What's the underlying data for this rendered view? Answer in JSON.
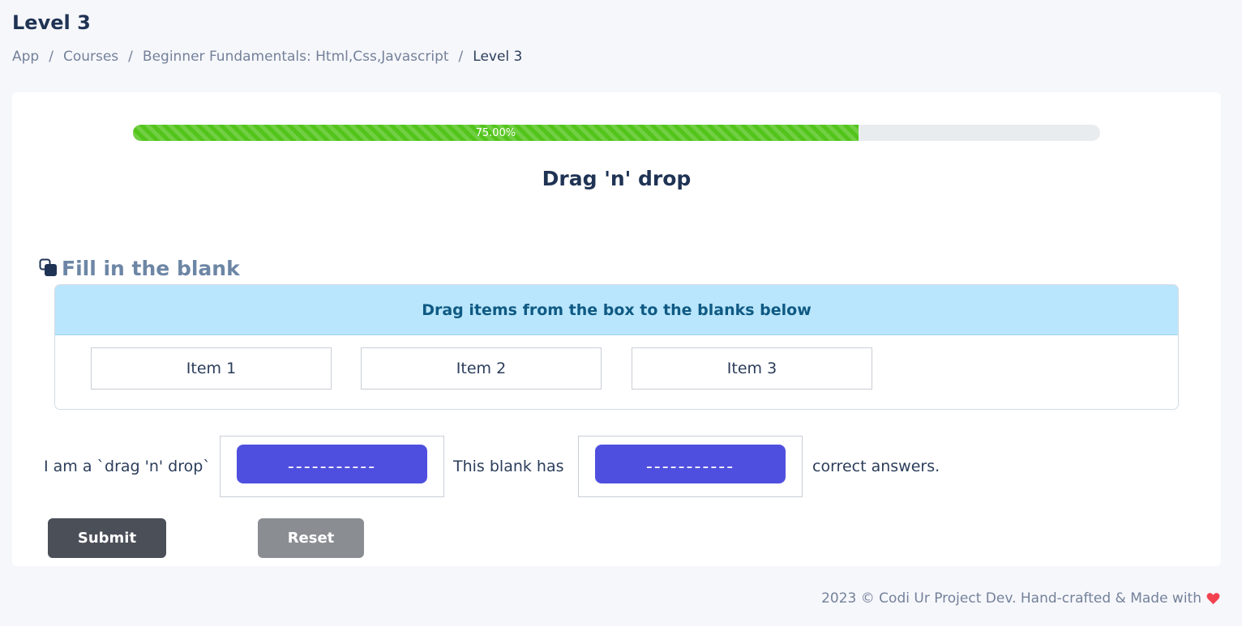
{
  "page": {
    "title": "Level 3"
  },
  "breadcrumb": {
    "items": [
      "App",
      "Courses",
      "Beginner Fundamentals: Html,Css,Javascript"
    ],
    "current": "Level 3",
    "separator": "/"
  },
  "progress": {
    "value": 0.75,
    "label": "75.00%",
    "color": "#52c41a"
  },
  "section": {
    "title": "Drag 'n' drop"
  },
  "question": {
    "icon": "copy-icon",
    "heading": "Fill in the blank",
    "instructions": "Drag items from the box to the blanks below",
    "items": [
      "Item 1",
      "Item 2",
      "Item 3"
    ],
    "sentence": {
      "part1": "I am a `drag 'n' drop`",
      "blank1": "-----------",
      "part2": "This blank has",
      "blank2": "-----------",
      "part3": "correct answers."
    }
  },
  "actions": {
    "submit_label": "Submit",
    "reset_label": "Reset"
  },
  "footer": {
    "text": "2023 © Codi Ur Project Dev. Hand-crafted & Made with",
    "icon": "heart-icon",
    "heart_color": "#f2414f"
  },
  "colors": {
    "chip": "#4f4fdf",
    "header_bg": "#b9e6fc"
  }
}
